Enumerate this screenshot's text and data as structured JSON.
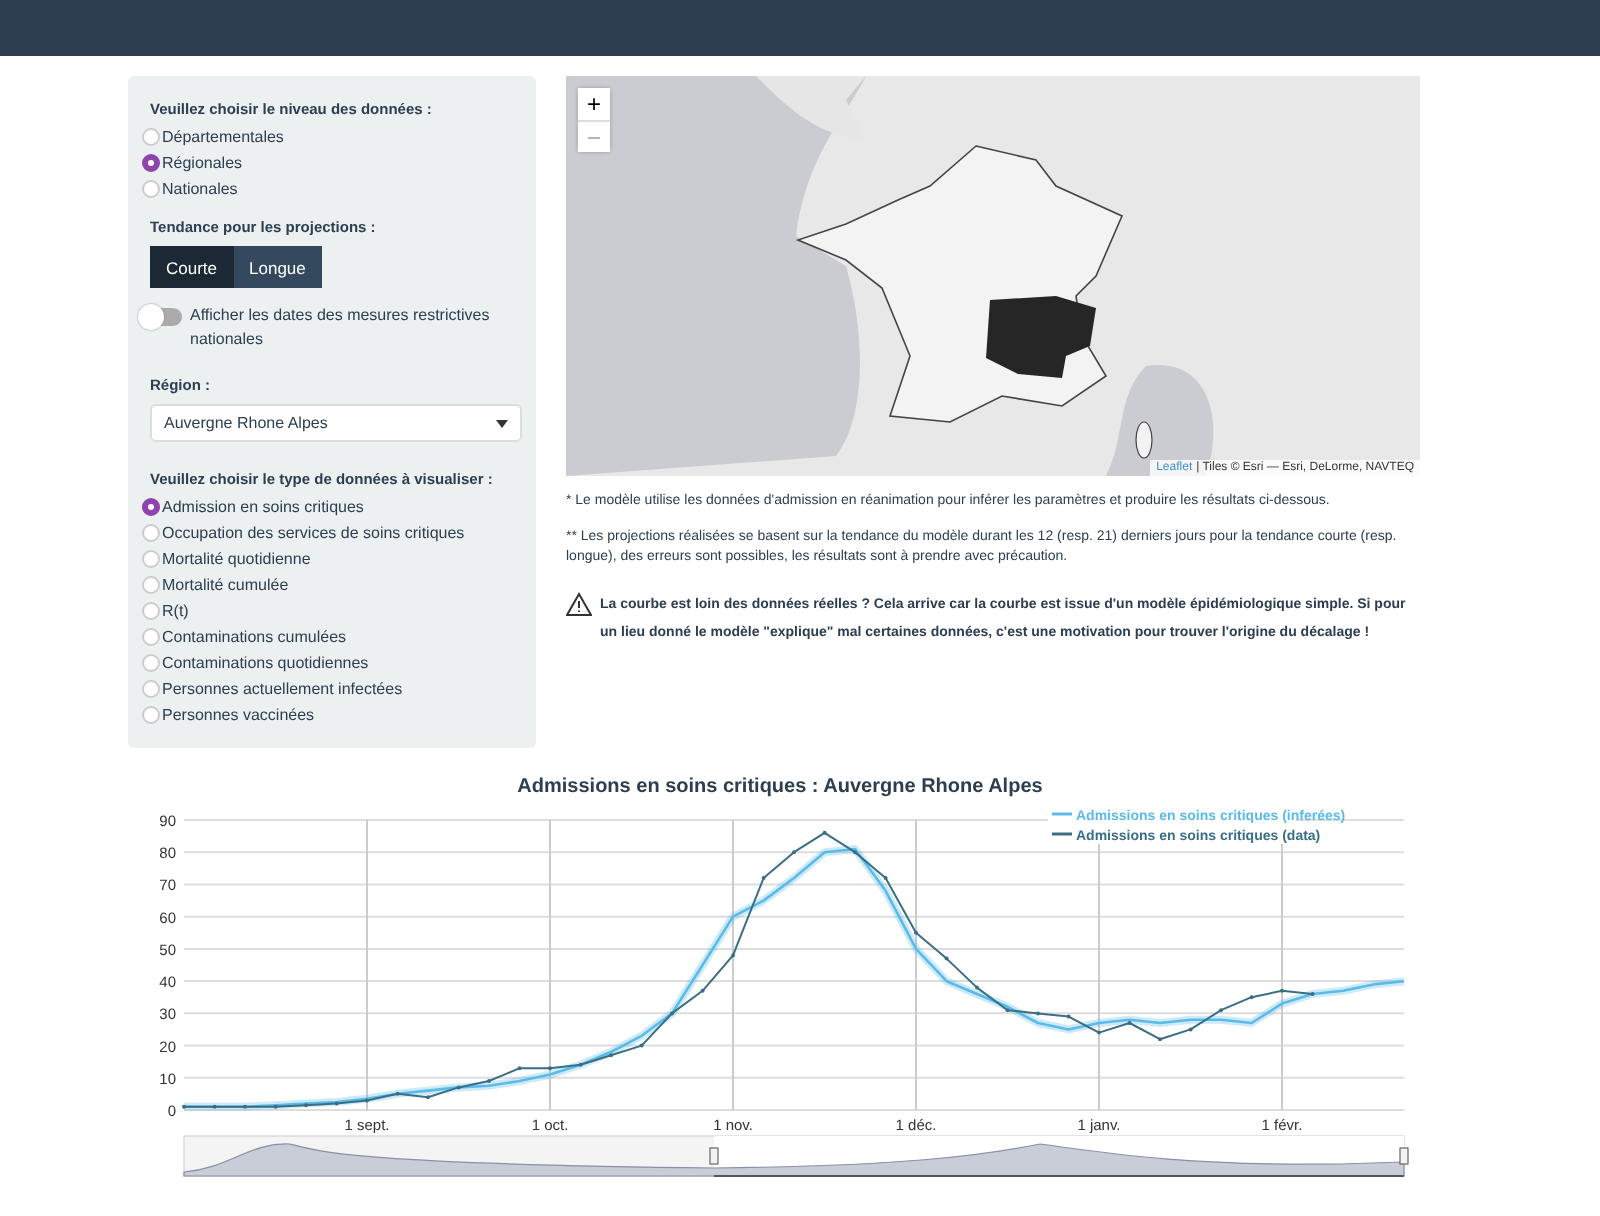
{
  "sidebar": {
    "level_label": "Veuillez choisir le niveau des données :",
    "levels": [
      {
        "label": "Départementales",
        "selected": false
      },
      {
        "label": "Régionales",
        "selected": true
      },
      {
        "label": "Nationales",
        "selected": false
      }
    ],
    "trend_label": "Tendance pour les projections :",
    "trends": [
      {
        "label": "Courte",
        "selected": true
      },
      {
        "label": "Longue",
        "selected": false
      }
    ],
    "toggle": {
      "label": "Afficher les dates des mesures restrictives nationales",
      "on": false
    },
    "region_label": "Région :",
    "region": {
      "value": "Auvergne Rhone Alpes"
    },
    "type_label": "Veuillez choisir le type de données à visualiser :",
    "types": [
      {
        "label": "Admission en soins critiques",
        "selected": true
      },
      {
        "label": "Occupation des services de soins critiques",
        "selected": false
      },
      {
        "label": "Mortalité quotidienne",
        "selected": false
      },
      {
        "label": "Mortalité cumulée",
        "selected": false
      },
      {
        "label": "R(t)",
        "selected": false
      },
      {
        "label": "Contaminations cumulées",
        "selected": false
      },
      {
        "label": "Contaminations quotidiennes",
        "selected": false
      },
      {
        "label": "Personnes actuellement infectées",
        "selected": false
      },
      {
        "label": "Personnes vaccinées",
        "selected": false
      }
    ]
  },
  "map": {
    "zoom_in": "+",
    "zoom_out": "−",
    "attribution_link": "Leaflet",
    "attribution": "| Tiles © Esri — Esri, DeLorme, NAVTEQ"
  },
  "notes": [
    "* Le modèle utilise les données d'admission en réanimation pour inférer les paramètres et produire les résultats ci-dessous.",
    "** Les projections réalisées se basent sur la tendance du modèle durant les 12 (resp. 21) derniers jours pour la tendance courte (resp. longue), des erreurs sont possibles, les résultats sont à prendre avec précaution."
  ],
  "warning": "La courbe est loin des données réelles ? Cela arrive car la courbe est issue d'un modèle épidémiologique simple. Si pour un lieu donné le modèle \"explique\" mal certaines données, c'est une motivation pour trouver l'origine du décalage !",
  "chart": {
    "chart_data": {
      "type": "line",
      "title": "Admissions en soins critiques : Auvergne Rhone Alpes",
      "categories": [
        null,
        null,
        null,
        null,
        null,
        null,
        "1 sept.",
        null,
        null,
        null,
        null,
        null,
        "1 oct.",
        null,
        null,
        null,
        null,
        null,
        "1 nov.",
        null,
        null,
        null,
        null,
        null,
        "1 déc.",
        null,
        null,
        null,
        null,
        null,
        "1 janv.",
        null,
        null,
        null,
        null,
        null,
        "1 févr.",
        null,
        null,
        null,
        null
      ],
      "ylim": [
        0,
        90
      ],
      "grid": true,
      "legend": true,
      "yticks": [
        0,
        10,
        20,
        30,
        40,
        50,
        60,
        70,
        80,
        90
      ],
      "series": [
        {
          "name": "Admissions en soins critiques (inferées)",
          "color": "#5bbbe8",
          "values": [
            1,
            1,
            1,
            1.5,
            2,
            2.5,
            3.5,
            5,
            6,
            7,
            7.5,
            9,
            11,
            14,
            18,
            23,
            30,
            45,
            60,
            65,
            72,
            80,
            81,
            68,
            50,
            40,
            36,
            32,
            27,
            25,
            27,
            28,
            27,
            28,
            28,
            27,
            33,
            36,
            37,
            39,
            40
          ]
        },
        {
          "name": "Admissions en soins critiques (data)",
          "color": "#3a6e85",
          "values": [
            1,
            1,
            1,
            1,
            1.5,
            2,
            3,
            5,
            4,
            7,
            9,
            13,
            13,
            14,
            17,
            20,
            30,
            37,
            48,
            72,
            80,
            86,
            80,
            72,
            55,
            47,
            38,
            31,
            30,
            29,
            24,
            27,
            22,
            25,
            31,
            35,
            37,
            36,
            null,
            null,
            null
          ]
        }
      ]
    }
  }
}
